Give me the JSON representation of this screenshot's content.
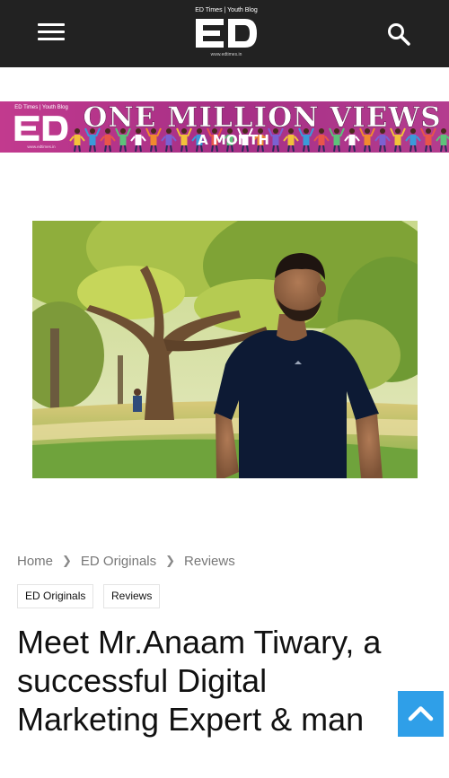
{
  "header": {
    "logo_tagline": "ED Times | Youth Blog",
    "logo_letters": "ED",
    "logo_url": "www.edtimes.in"
  },
  "banner": {
    "logo_tagline": "ED Times | Youth Blog",
    "logo_letters": "ED",
    "logo_url": "www.edtimes.in",
    "headline": "ONE MILLION VIEWS",
    "subline": "A MONTH"
  },
  "breadcrumb": {
    "items": [
      "Home",
      "ED Originals",
      "Reviews"
    ]
  },
  "tags": [
    "ED Originals",
    "Reviews"
  ],
  "article": {
    "title": "Meet Mr.Anaam Tiwary, a successful Digital Marketing Expert & man"
  },
  "colors": {
    "topbar": "#222222",
    "banner": "#b3368c",
    "back_to_top": "#2f9fe8"
  },
  "icons": [
    "menu-icon",
    "search-icon",
    "chevron-right-icon",
    "chevron-up-icon"
  ]
}
